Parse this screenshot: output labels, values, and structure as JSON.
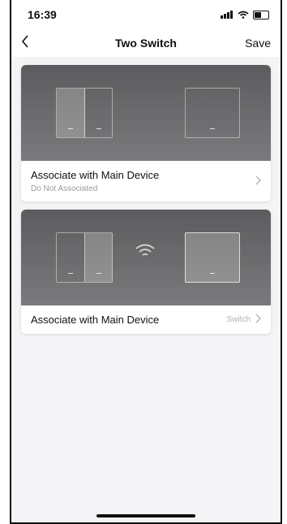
{
  "status_bar": {
    "time": "16:39"
  },
  "nav": {
    "title": "Two Switch",
    "save_label": "Save"
  },
  "cards": [
    {
      "title": "Associate with Main Device",
      "subtitle": "Do Not Associated"
    },
    {
      "title": "Associate with Main Device",
      "value": "Switch"
    }
  ]
}
